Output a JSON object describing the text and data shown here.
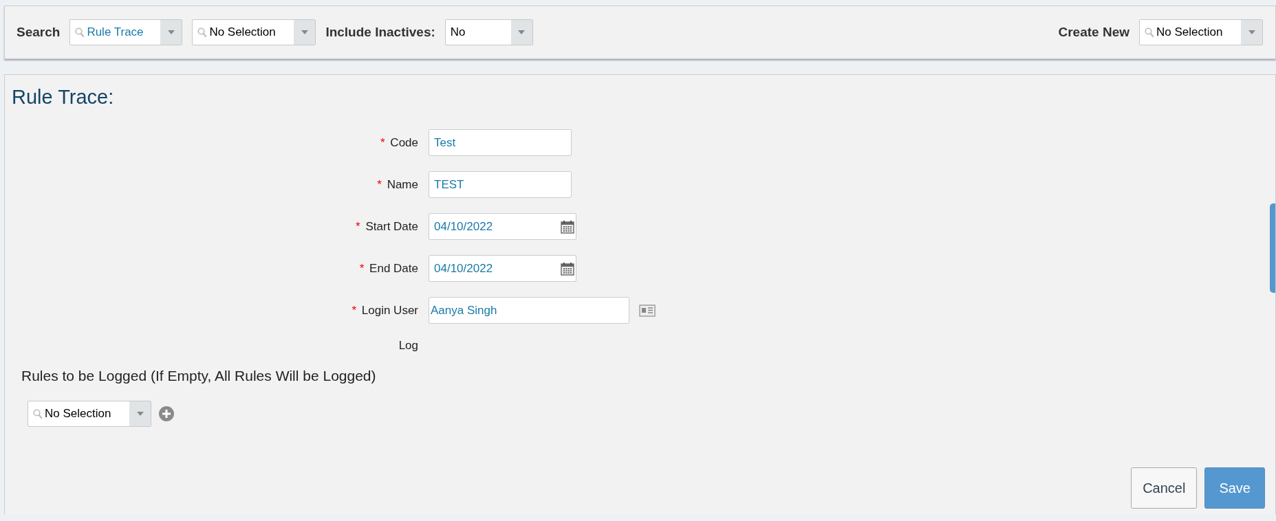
{
  "toolbar": {
    "search_label": "Search",
    "search_combos": [
      {
        "value": "Rule Trace",
        "highlighted": true
      },
      {
        "value": "No Selection",
        "highlighted": false
      }
    ],
    "inactives_label": "Include Inactives:",
    "inactives_value": "No",
    "create_label": "Create New",
    "create_value": "No Selection"
  },
  "panel": {
    "title": "Rule Trace:",
    "fields": [
      {
        "label": "Code",
        "required_mark": "*",
        "kind": "text",
        "value": "Test"
      },
      {
        "label": "Name",
        "required_mark": "*",
        "kind": "text",
        "value": "TEST"
      },
      {
        "label": "Start Date",
        "required_mark": "*",
        "kind": "date",
        "value": "04/10/2022"
      },
      {
        "label": "End Date",
        "required_mark": "*",
        "kind": "date",
        "value": "04/10/2022"
      },
      {
        "label": "Login User",
        "required_mark": "*",
        "kind": "lookup",
        "value": "Aanya Singh"
      },
      {
        "label": "Log",
        "kind": "none"
      }
    ],
    "rules_heading": "Rules to be Logged (If Empty, All Rules Will be Logged)",
    "rules_combo": "No Selection",
    "buttons": [
      {
        "label": "Cancel",
        "kind": "secondary"
      },
      {
        "label": "Save",
        "kind": "primary"
      }
    ]
  }
}
